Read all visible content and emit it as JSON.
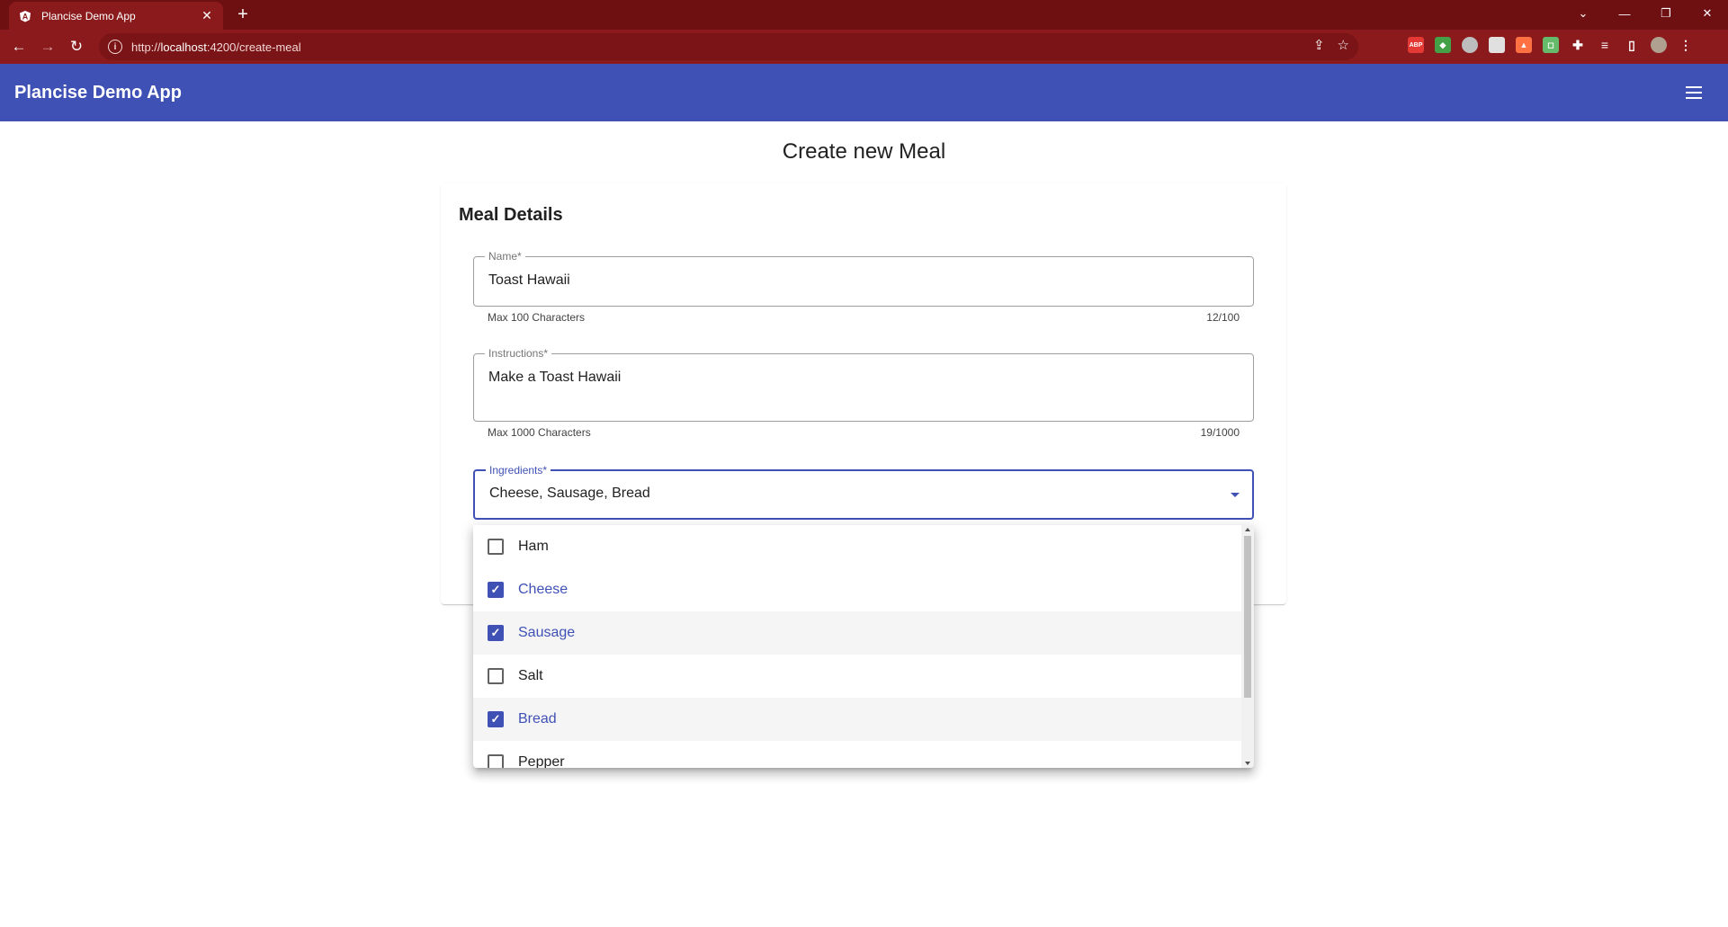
{
  "browser": {
    "tab_title": "Plancise Demo App",
    "url_prefix": "http://",
    "url_host": "localhost",
    "url_path": ":4200/create-meal"
  },
  "app": {
    "title": "Plancise Demo App"
  },
  "page": {
    "title": "Create new Meal",
    "card_title": "Meal Details"
  },
  "form": {
    "name": {
      "label": "Name*",
      "value": "Toast Hawaii",
      "hint": "Max 100 Characters",
      "counter": "12/100"
    },
    "instructions": {
      "label": "Instructions*",
      "value": "Make a Toast Hawaii",
      "hint": "Max 1000 Characters",
      "counter": "19/1000"
    },
    "ingredients": {
      "label": "Ingredients*",
      "value": "Cheese, Sausage, Bread",
      "options": [
        {
          "label": "Ham",
          "checked": false
        },
        {
          "label": "Cheese",
          "checked": true
        },
        {
          "label": "Sausage",
          "checked": true
        },
        {
          "label": "Salt",
          "checked": false
        },
        {
          "label": "Bread",
          "checked": true
        },
        {
          "label": "Pepper",
          "checked": false
        }
      ]
    }
  },
  "colors": {
    "browser_frame": "#6e1012",
    "primary": "#3f51b5"
  }
}
